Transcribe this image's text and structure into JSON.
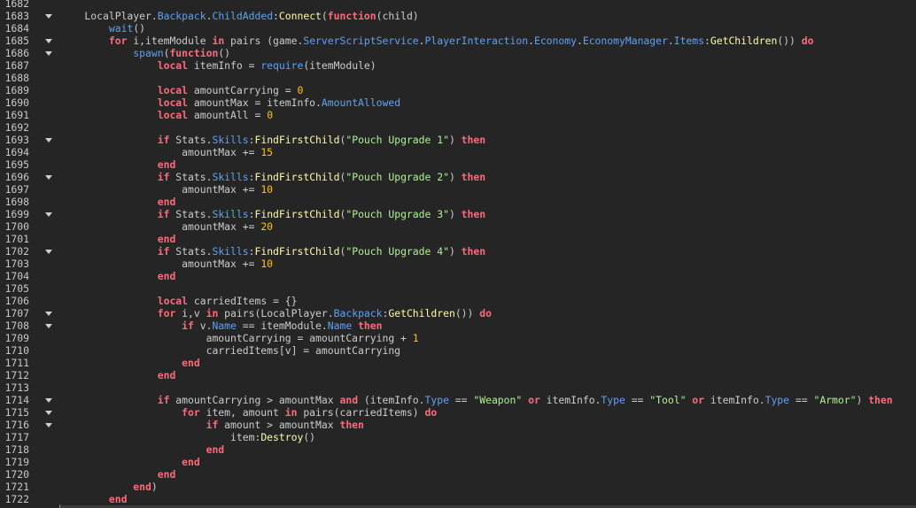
{
  "colors": {
    "background": "#252525",
    "keyword": "#f86d7c",
    "text": "#cccccc",
    "property": "#61a1f1",
    "method": "#fdfbac",
    "string": "#adf195",
    "number": "#ffc600"
  },
  "lines": [
    {
      "n": "1682",
      "fold": false,
      "tokens": []
    },
    {
      "n": "1683",
      "fold": true,
      "tokens": [
        [
          "t",
          "    LocalPlayer."
        ],
        [
          "p",
          "Backpack"
        ],
        [
          "t",
          "."
        ],
        [
          "p",
          "ChildAdded"
        ],
        [
          "t",
          ":"
        ],
        [
          "m",
          "Connect"
        ],
        [
          "t",
          "("
        ],
        [
          "k",
          "function"
        ],
        [
          "t",
          "(child)"
        ]
      ]
    },
    {
      "n": "1684",
      "fold": false,
      "tokens": [
        [
          "t",
          "        "
        ],
        [
          "p",
          "wait"
        ],
        [
          "t",
          "()"
        ]
      ]
    },
    {
      "n": "1685",
      "fold": true,
      "tokens": [
        [
          "t",
          "        "
        ],
        [
          "k",
          "for"
        ],
        [
          "t",
          " i,itemModule "
        ],
        [
          "k",
          "in"
        ],
        [
          "t",
          " pairs (game."
        ],
        [
          "p",
          "ServerScriptService"
        ],
        [
          "t",
          "."
        ],
        [
          "p",
          "PlayerInteraction"
        ],
        [
          "t",
          "."
        ],
        [
          "p",
          "Economy"
        ],
        [
          "t",
          "."
        ],
        [
          "p",
          "EconomyManager"
        ],
        [
          "t",
          "."
        ],
        [
          "p",
          "Items"
        ],
        [
          "t",
          ":"
        ],
        [
          "m",
          "GetChildren"
        ],
        [
          "t",
          "()) "
        ],
        [
          "k",
          "do"
        ]
      ]
    },
    {
      "n": "1686",
      "fold": true,
      "tokens": [
        [
          "t",
          "            "
        ],
        [
          "p",
          "spawn"
        ],
        [
          "t",
          "("
        ],
        [
          "k",
          "function"
        ],
        [
          "t",
          "()"
        ]
      ]
    },
    {
      "n": "1687",
      "fold": false,
      "tokens": [
        [
          "t",
          "                "
        ],
        [
          "k",
          "local"
        ],
        [
          "t",
          " itemInfo = "
        ],
        [
          "p",
          "require"
        ],
        [
          "t",
          "(itemModule)"
        ]
      ]
    },
    {
      "n": "1688",
      "fold": false,
      "tokens": []
    },
    {
      "n": "1689",
      "fold": false,
      "tokens": [
        [
          "t",
          "                "
        ],
        [
          "k",
          "local"
        ],
        [
          "t",
          " amountCarrying = "
        ],
        [
          "n",
          "0"
        ]
      ]
    },
    {
      "n": "1690",
      "fold": false,
      "tokens": [
        [
          "t",
          "                "
        ],
        [
          "k",
          "local"
        ],
        [
          "t",
          " amountMax = itemInfo."
        ],
        [
          "p",
          "AmountAllowed"
        ]
      ]
    },
    {
      "n": "1691",
      "fold": false,
      "tokens": [
        [
          "t",
          "                "
        ],
        [
          "k",
          "local"
        ],
        [
          "t",
          " amountAll = "
        ],
        [
          "n",
          "0"
        ]
      ]
    },
    {
      "n": "1692",
      "fold": false,
      "tokens": []
    },
    {
      "n": "1693",
      "fold": true,
      "tokens": [
        [
          "t",
          "                "
        ],
        [
          "k",
          "if"
        ],
        [
          "t",
          " Stats."
        ],
        [
          "p",
          "Skills"
        ],
        [
          "t",
          ":"
        ],
        [
          "m",
          "FindFirstChild"
        ],
        [
          "t",
          "("
        ],
        [
          "s",
          "\"Pouch Upgrade 1\""
        ],
        [
          "t",
          ") "
        ],
        [
          "k",
          "then"
        ]
      ]
    },
    {
      "n": "1694",
      "fold": false,
      "tokens": [
        [
          "t",
          "                    amountMax += "
        ],
        [
          "n",
          "15"
        ]
      ]
    },
    {
      "n": "1695",
      "fold": false,
      "tokens": [
        [
          "t",
          "                "
        ],
        [
          "k",
          "end"
        ]
      ]
    },
    {
      "n": "1696",
      "fold": true,
      "tokens": [
        [
          "t",
          "                "
        ],
        [
          "k",
          "if"
        ],
        [
          "t",
          " Stats."
        ],
        [
          "p",
          "Skills"
        ],
        [
          "t",
          ":"
        ],
        [
          "m",
          "FindFirstChild"
        ],
        [
          "t",
          "("
        ],
        [
          "s",
          "\"Pouch Upgrade 2\""
        ],
        [
          "t",
          ") "
        ],
        [
          "k",
          "then"
        ]
      ]
    },
    {
      "n": "1697",
      "fold": false,
      "tokens": [
        [
          "t",
          "                    amountMax += "
        ],
        [
          "n",
          "10"
        ]
      ]
    },
    {
      "n": "1698",
      "fold": false,
      "tokens": [
        [
          "t",
          "                "
        ],
        [
          "k",
          "end"
        ]
      ]
    },
    {
      "n": "1699",
      "fold": true,
      "tokens": [
        [
          "t",
          "                "
        ],
        [
          "k",
          "if"
        ],
        [
          "t",
          " Stats."
        ],
        [
          "p",
          "Skills"
        ],
        [
          "t",
          ":"
        ],
        [
          "m",
          "FindFirstChild"
        ],
        [
          "t",
          "("
        ],
        [
          "s",
          "\"Pouch Upgrade 3\""
        ],
        [
          "t",
          ") "
        ],
        [
          "k",
          "then"
        ]
      ]
    },
    {
      "n": "1700",
      "fold": false,
      "tokens": [
        [
          "t",
          "                    amountMax += "
        ],
        [
          "n",
          "20"
        ]
      ]
    },
    {
      "n": "1701",
      "fold": false,
      "tokens": [
        [
          "t",
          "                "
        ],
        [
          "k",
          "end"
        ]
      ]
    },
    {
      "n": "1702",
      "fold": true,
      "tokens": [
        [
          "t",
          "                "
        ],
        [
          "k",
          "if"
        ],
        [
          "t",
          " Stats."
        ],
        [
          "p",
          "Skills"
        ],
        [
          "t",
          ":"
        ],
        [
          "m",
          "FindFirstChild"
        ],
        [
          "t",
          "("
        ],
        [
          "s",
          "\"Pouch Upgrade 4\""
        ],
        [
          "t",
          ") "
        ],
        [
          "k",
          "then"
        ]
      ]
    },
    {
      "n": "1703",
      "fold": false,
      "tokens": [
        [
          "t",
          "                    amountMax += "
        ],
        [
          "n",
          "10"
        ]
      ]
    },
    {
      "n": "1704",
      "fold": false,
      "tokens": [
        [
          "t",
          "                "
        ],
        [
          "k",
          "end"
        ]
      ]
    },
    {
      "n": "1705",
      "fold": false,
      "tokens": []
    },
    {
      "n": "1706",
      "fold": false,
      "tokens": [
        [
          "t",
          "                "
        ],
        [
          "k",
          "local"
        ],
        [
          "t",
          " carriedItems = {}"
        ]
      ]
    },
    {
      "n": "1707",
      "fold": true,
      "tokens": [
        [
          "t",
          "                "
        ],
        [
          "k",
          "for"
        ],
        [
          "t",
          " i,v "
        ],
        [
          "k",
          "in"
        ],
        [
          "t",
          " pairs(LocalPlayer."
        ],
        [
          "p",
          "Backpack"
        ],
        [
          "t",
          ":"
        ],
        [
          "m",
          "GetChildren"
        ],
        [
          "t",
          "()) "
        ],
        [
          "k",
          "do"
        ]
      ]
    },
    {
      "n": "1708",
      "fold": true,
      "tokens": [
        [
          "t",
          "                    "
        ],
        [
          "k",
          "if"
        ],
        [
          "t",
          " v."
        ],
        [
          "p",
          "Name"
        ],
        [
          "t",
          " == itemModule."
        ],
        [
          "p",
          "Name"
        ],
        [
          "t",
          " "
        ],
        [
          "k",
          "then"
        ]
      ]
    },
    {
      "n": "1709",
      "fold": false,
      "tokens": [
        [
          "t",
          "                        amountCarrying = amountCarrying + "
        ],
        [
          "n",
          "1"
        ]
      ]
    },
    {
      "n": "1710",
      "fold": false,
      "tokens": [
        [
          "t",
          "                        carriedItems[v] = amountCarrying"
        ]
      ]
    },
    {
      "n": "1711",
      "fold": false,
      "tokens": [
        [
          "t",
          "                    "
        ],
        [
          "k",
          "end"
        ]
      ]
    },
    {
      "n": "1712",
      "fold": false,
      "tokens": [
        [
          "t",
          "                "
        ],
        [
          "k",
          "end"
        ]
      ]
    },
    {
      "n": "1713",
      "fold": false,
      "tokens": []
    },
    {
      "n": "1714",
      "fold": true,
      "tokens": [
        [
          "t",
          "                "
        ],
        [
          "k",
          "if"
        ],
        [
          "t",
          " amountCarrying > amountMax "
        ],
        [
          "k",
          "and"
        ],
        [
          "t",
          " (itemInfo."
        ],
        [
          "p",
          "Type"
        ],
        [
          "t",
          " == "
        ],
        [
          "s",
          "\"Weapon\""
        ],
        [
          "t",
          " "
        ],
        [
          "k",
          "or"
        ],
        [
          "t",
          " itemInfo."
        ],
        [
          "p",
          "Type"
        ],
        [
          "t",
          " == "
        ],
        [
          "s",
          "\"Tool\""
        ],
        [
          "t",
          " "
        ],
        [
          "k",
          "or"
        ],
        [
          "t",
          " itemInfo."
        ],
        [
          "p",
          "Type"
        ],
        [
          "t",
          " == "
        ],
        [
          "s",
          "\"Armor\""
        ],
        [
          "t",
          ") "
        ],
        [
          "k",
          "then"
        ]
      ]
    },
    {
      "n": "1715",
      "fold": true,
      "tokens": [
        [
          "t",
          "                    "
        ],
        [
          "k",
          "for"
        ],
        [
          "t",
          " item, amount "
        ],
        [
          "k",
          "in"
        ],
        [
          "t",
          " pairs(carriedItems) "
        ],
        [
          "k",
          "do"
        ]
      ]
    },
    {
      "n": "1716",
      "fold": true,
      "tokens": [
        [
          "t",
          "                        "
        ],
        [
          "k",
          "if"
        ],
        [
          "t",
          " amount > amountMax "
        ],
        [
          "k",
          "then"
        ]
      ]
    },
    {
      "n": "1717",
      "fold": false,
      "tokens": [
        [
          "t",
          "                            item:"
        ],
        [
          "m",
          "Destroy"
        ],
        [
          "t",
          "()"
        ]
      ]
    },
    {
      "n": "1718",
      "fold": false,
      "tokens": [
        [
          "t",
          "                        "
        ],
        [
          "k",
          "end"
        ]
      ]
    },
    {
      "n": "1719",
      "fold": false,
      "tokens": [
        [
          "t",
          "                    "
        ],
        [
          "k",
          "end"
        ]
      ]
    },
    {
      "n": "1720",
      "fold": false,
      "tokens": [
        [
          "t",
          "                "
        ],
        [
          "k",
          "end"
        ]
      ]
    },
    {
      "n": "1721",
      "fold": false,
      "tokens": [
        [
          "t",
          "            "
        ],
        [
          "k",
          "end"
        ],
        [
          "t",
          ")"
        ]
      ]
    },
    {
      "n": "1722",
      "fold": false,
      "tokens": [
        [
          "t",
          "        "
        ],
        [
          "k",
          "end"
        ]
      ]
    }
  ]
}
